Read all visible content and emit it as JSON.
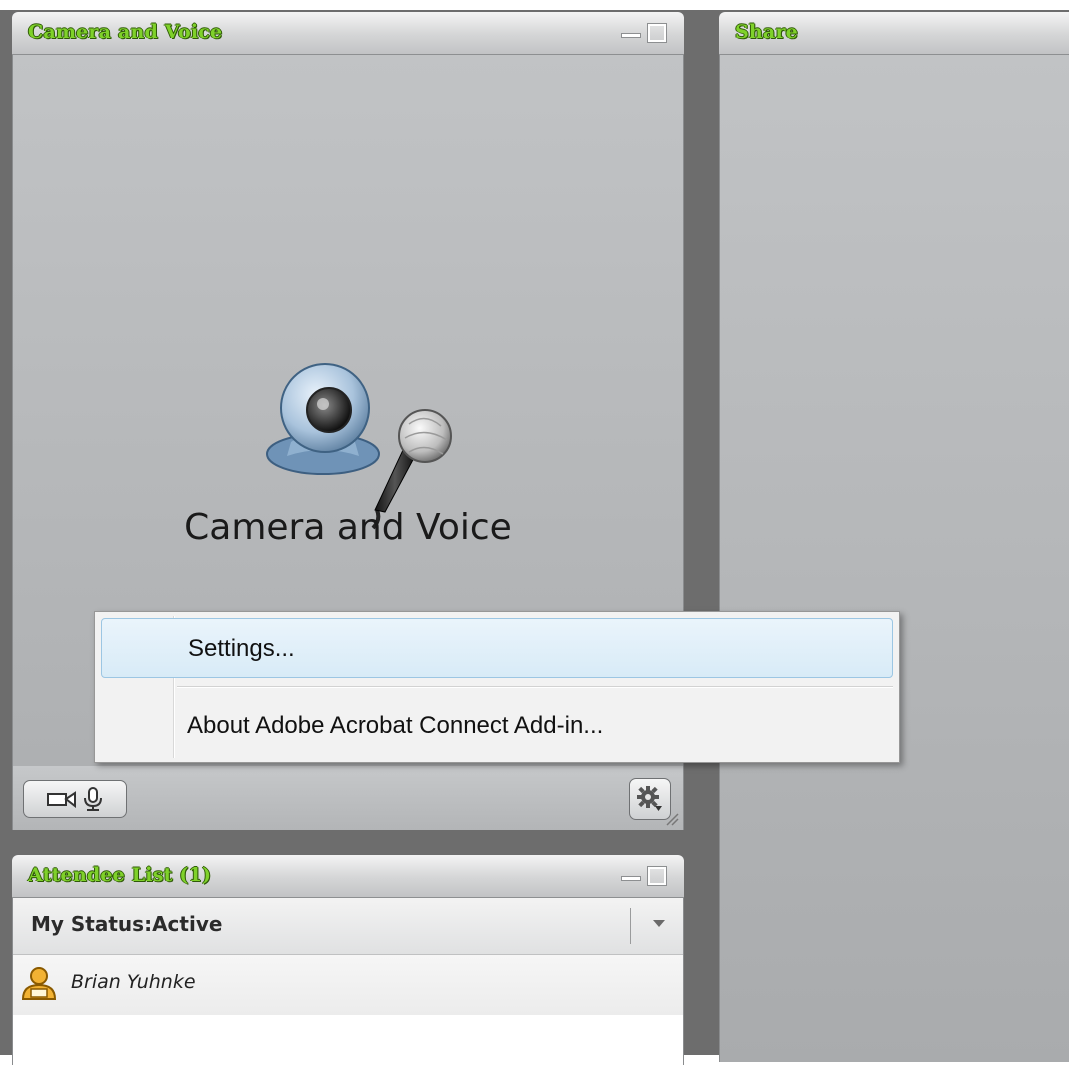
{
  "camera_pod": {
    "title": "Camera and Voice",
    "placeholder_title": "Camera and Voice"
  },
  "share_pod": {
    "title": "Share"
  },
  "attendee_pod": {
    "title": "Attendee List (1)",
    "status_text": "My Status:Active",
    "attendees": [
      {
        "name": "Brian Yuhnke"
      }
    ]
  },
  "context_menu": {
    "items": [
      {
        "label": "Settings..."
      },
      {
        "label": "About Adobe Acrobat Connect Add-in..."
      }
    ]
  },
  "colors": {
    "title_green": "#7fd12a",
    "background": "#6d6d6d",
    "menu_highlight": "#d8ebf7"
  },
  "icons": {
    "placeholder": [
      "webcam-icon",
      "microphone-icon"
    ],
    "footer": [
      "camera-icon",
      "microphone-icon",
      "gear-icon"
    ],
    "attendee": "host-user-icon"
  }
}
